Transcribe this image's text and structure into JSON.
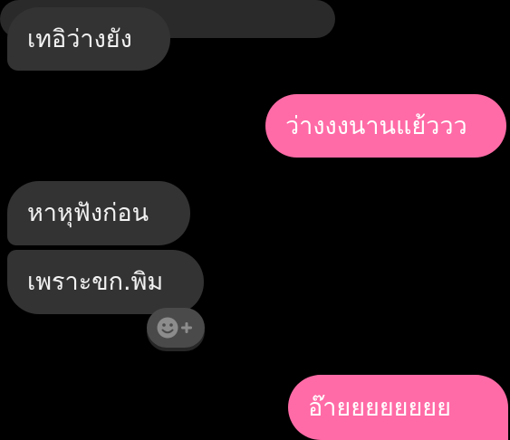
{
  "messages": [
    {
      "text": "เทอิว่างยัง",
      "from": "them"
    },
    {
      "text": "ว่างงงนานแย้ววว",
      "from": "me"
    },
    {
      "text": "หาหุฟังก่อน",
      "from": "them"
    },
    {
      "text": "เพราะขก.พิม",
      "from": "them"
    },
    {
      "text": "อ๊ายยยยยยยย",
      "from": "me"
    }
  ],
  "reaction_button": {
    "icon": "add-reaction-icon"
  },
  "colors": {
    "background": "#000000",
    "incoming_bubble": "#333333",
    "outgoing_bubble": "#ff6ba6",
    "text": "#ffffff"
  }
}
